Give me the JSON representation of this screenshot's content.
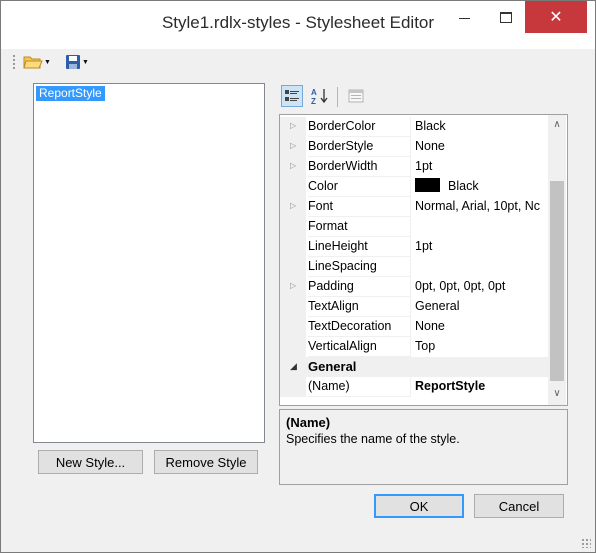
{
  "window": {
    "title": "Style1.rdlx-styles - Stylesheet Editor",
    "minimize_glyph": "–",
    "maximize_glyph": "☐",
    "close_glyph": "✕"
  },
  "toolbar": {
    "open_icon": "folder-open-icon",
    "save_icon": "floppy-disk-icon"
  },
  "style_list": {
    "items": [
      "ReportStyle"
    ],
    "selected": "ReportStyle"
  },
  "buttons": {
    "new_style": "New Style...",
    "remove_style": "Remove Style",
    "ok": "OK",
    "cancel": "Cancel"
  },
  "property_grid": {
    "rows": [
      {
        "name": "BorderColor",
        "value": "Black",
        "expandable": true
      },
      {
        "name": "BorderStyle",
        "value": "None",
        "expandable": true
      },
      {
        "name": "BorderWidth",
        "value": "1pt",
        "expandable": true
      },
      {
        "name": "Color",
        "value": "Black",
        "expandable": false,
        "swatch": "#000000"
      },
      {
        "name": "Font",
        "value": "Normal, Arial, 10pt, Nc",
        "expandable": true
      },
      {
        "name": "Format",
        "value": "",
        "expandable": false
      },
      {
        "name": "LineHeight",
        "value": "1pt",
        "expandable": false
      },
      {
        "name": "LineSpacing",
        "value": "",
        "expandable": false
      },
      {
        "name": "Padding",
        "value": "0pt, 0pt, 0pt, 0pt",
        "expandable": true
      },
      {
        "name": "TextAlign",
        "value": "General",
        "expandable": false
      },
      {
        "name": "TextDecoration",
        "value": "None",
        "expandable": false
      },
      {
        "name": "VerticalAlign",
        "value": "Top",
        "expandable": false
      }
    ],
    "category": "General",
    "category_rows": [
      {
        "name": "(Name)",
        "value": "ReportStyle"
      }
    ]
  },
  "description": {
    "title": "(Name)",
    "text": "Specifies the name of the style."
  },
  "colors": {
    "selection": "#3399ff",
    "close_button": "#c7383c",
    "window_bg": "#f0f0f0"
  }
}
